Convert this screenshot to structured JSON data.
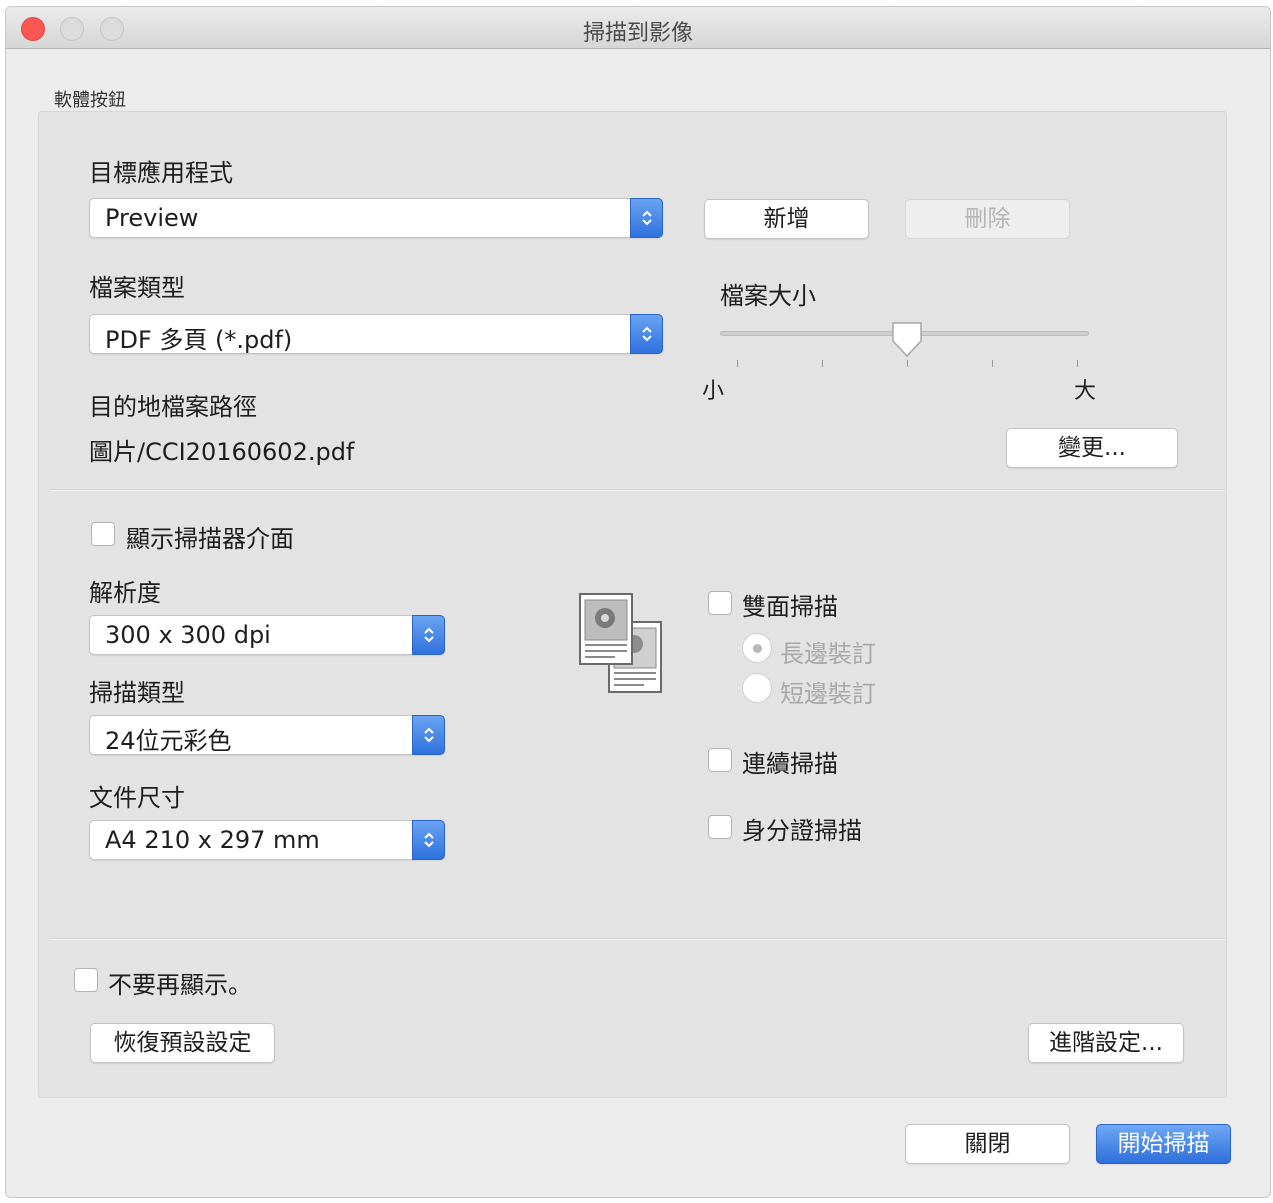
{
  "window": {
    "title": "掃描到影像"
  },
  "software_button": {
    "group_label": "軟體按鈕",
    "target_app_label": "目標應用程式",
    "target_app_value": "Preview",
    "add_label": "新增",
    "delete_label": "刪除",
    "file_type_label": "檔案類型",
    "file_type_value": "PDF 多頁 (*.pdf)",
    "file_size_label": "檔案大小",
    "file_size_min": "小",
    "file_size_max": "大",
    "file_size_level": 0.5,
    "dest_path_label": "目的地檔案路徑",
    "dest_path_value": "圖片/CCI20160602.pdf",
    "change_label": "變更..."
  },
  "scan_settings": {
    "show_scanner_ui_label": "顯示掃描器介面",
    "show_scanner_ui_checked": false,
    "resolution_label": "解析度",
    "resolution_value": "300 x 300 dpi",
    "scan_type_label": "掃描類型",
    "scan_type_value": "24位元彩色",
    "doc_size_label": "文件尺寸",
    "doc_size_value": "A4 210 x 297 mm",
    "duplex_label": "雙面掃描",
    "duplex_checked": false,
    "long_edge_label": "長邊裝訂",
    "long_edge_selected": true,
    "short_edge_label": "短邊裝訂",
    "short_edge_selected": false,
    "continuous_label": "連續掃描",
    "continuous_checked": false,
    "id_card_label": "身分證掃描",
    "id_card_checked": false,
    "document_icon": "duplex-document-icon"
  },
  "footer": {
    "dont_show_label": "不要再顯示。",
    "dont_show_checked": false,
    "restore_defaults_label": "恢復預設設定",
    "advanced_label": "進階設定...",
    "close_label": "關閉",
    "start_scan_label": "開始掃描"
  },
  "colors": {
    "accent": "#2e6fdb",
    "close_traffic_light": "#fc5753",
    "panel_bg": "#e3e3e3",
    "window_bg": "#ececec"
  }
}
